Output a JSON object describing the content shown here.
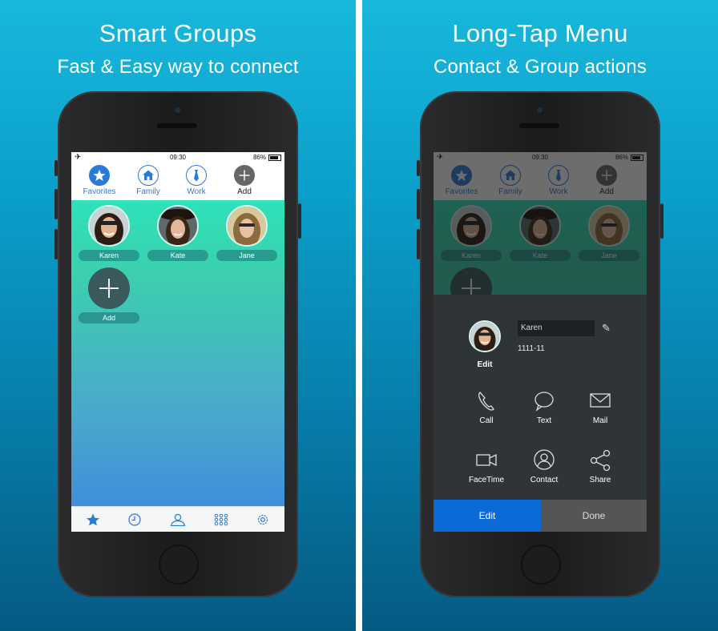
{
  "left": {
    "title": "Smart Groups",
    "subtitle": "Fast & Easy way to connect"
  },
  "right": {
    "title": "Long-Tap Menu",
    "subtitle": "Contact & Group actions"
  },
  "statusbar": {
    "time": "09:30",
    "battery": "86%"
  },
  "tabs": [
    {
      "label": "Favorites",
      "icon": "star-icon"
    },
    {
      "label": "Family",
      "icon": "home-icon"
    },
    {
      "label": "Work",
      "icon": "tie-icon"
    },
    {
      "label": "Add",
      "icon": "plus-icon"
    }
  ],
  "contacts": [
    {
      "name": "Karen"
    },
    {
      "name": "Kate"
    },
    {
      "name": "Jane"
    },
    {
      "name": "Add"
    }
  ],
  "bottom_tabs": [
    "star-icon",
    "clock-icon",
    "person-icon",
    "grid-icon",
    "gear-icon"
  ],
  "sheet": {
    "name_value": "Karen",
    "number": "1111-11",
    "avatar_label": "Edit",
    "actions": [
      {
        "label": "Call",
        "icon": "phone-icon"
      },
      {
        "label": "Text",
        "icon": "message-icon"
      },
      {
        "label": "Mail",
        "icon": "mail-icon"
      },
      {
        "label": "FaceTime",
        "icon": "video-icon"
      },
      {
        "label": "Contact",
        "icon": "contact-icon"
      },
      {
        "label": "Share",
        "icon": "share-icon"
      }
    ],
    "edit_button": "Edit",
    "done_button": "Done"
  },
  "colors": {
    "accent": "#2a7bd8",
    "edit_button": "#0a6ad6",
    "done_button": "#555555",
    "content_top": "#2ee2b9",
    "content_bottom": "#3f8fd9"
  }
}
